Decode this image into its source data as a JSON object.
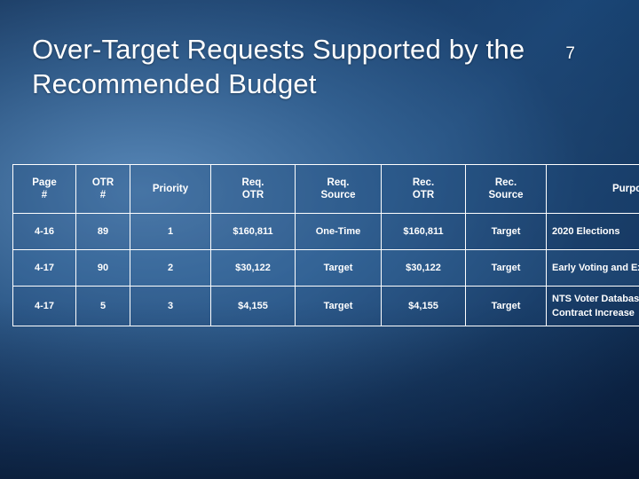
{
  "slide": {
    "title": "Over-Target Requests Supported by the Recommended Budget",
    "number": "7"
  },
  "table": {
    "headers": {
      "page": "Page #",
      "page_l1": "Page",
      "page_l2": "#",
      "otr_num_l1": "OTR",
      "otr_num_l2": "#",
      "priority": "Priority",
      "req_otr_l1": "Req.",
      "req_otr_l2": "OTR",
      "req_source_l1": "Req.",
      "req_source_l2": "Source",
      "rec_otr_l1": "Rec.",
      "rec_otr_l2": "OTR",
      "rec_source_l1": "Rec.",
      "rec_source_l2": "Source",
      "purpose": "Purpose"
    },
    "rows": [
      {
        "page": "4-16",
        "otr_num": "89",
        "priority": "1",
        "req_otr": "$160,811",
        "req_source": "One-Time",
        "rec_otr": "$160,811",
        "rec_source": "Target",
        "purpose": "2020 Elections"
      },
      {
        "page": "4-17",
        "otr_num": "90",
        "priority": "2",
        "req_otr": "$30,122",
        "req_source": "Target",
        "rec_otr": "$30,122",
        "rec_source": "Target",
        "purpose": "Early Voting and Extended Hours"
      },
      {
        "page": "4-17",
        "otr_num": "5",
        "priority": "3",
        "req_otr": "$4,155",
        "req_source": "Target",
        "rec_otr": "$4,155",
        "rec_source": "Target",
        "purpose": "NTS Voter Database Software Contract Increase"
      }
    ]
  }
}
